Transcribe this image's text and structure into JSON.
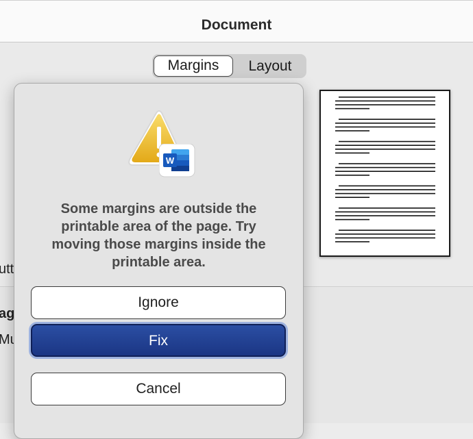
{
  "window": {
    "title": "Document"
  },
  "tabs": [
    {
      "label": "Margins",
      "selected": true
    },
    {
      "label": "Layout",
      "selected": false
    }
  ],
  "background": {
    "partial_label_1": "utt",
    "partial_label_2": "ag",
    "partial_label_3": "Mu"
  },
  "dialog": {
    "icon": "warning-word-icon",
    "app_badge_letter": "W",
    "message": "Some margins are outside the printable area of the page. Try moving those margins inside the printable area.",
    "buttons": {
      "ignore": "Ignore",
      "fix": "Fix",
      "cancel": "Cancel"
    }
  },
  "colors": {
    "accent_button": "#1f3d8f",
    "warning_yellow": "#f0c21c",
    "word_blue": "#185abd"
  }
}
